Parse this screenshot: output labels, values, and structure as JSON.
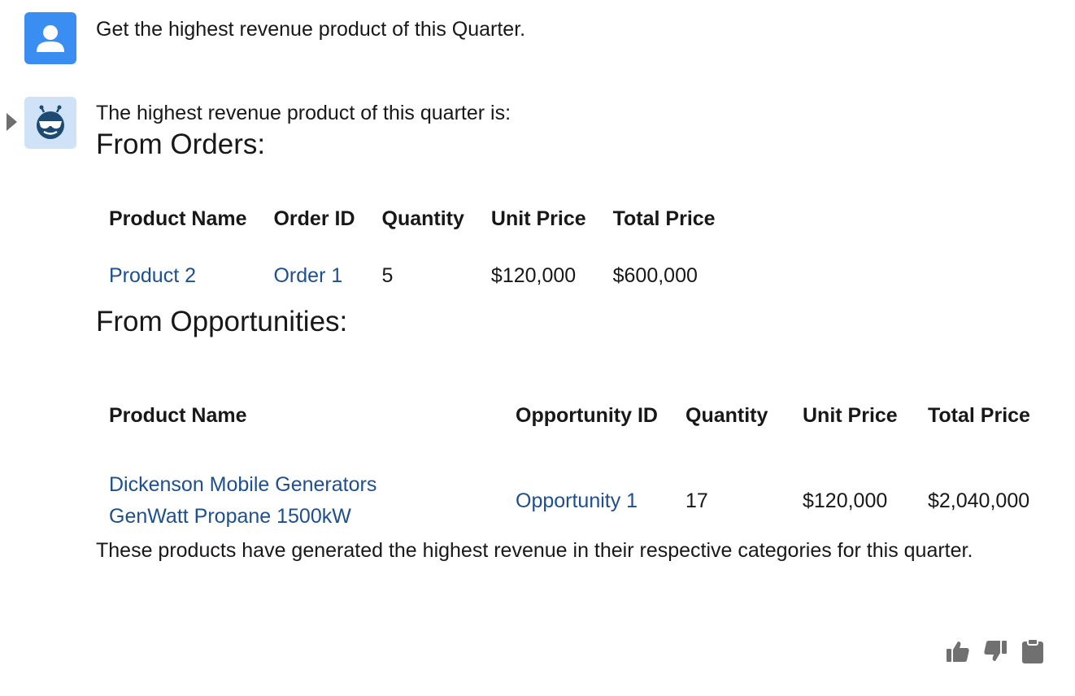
{
  "user_message": {
    "text": "Get the highest revenue product of this Quarter."
  },
  "bot_message": {
    "intro": "The highest revenue product of this quarter is:",
    "orders_section": {
      "heading": "From Orders:",
      "columns": [
        "Product Name",
        "Order ID",
        "Quantity",
        "Unit Price",
        "Total Price"
      ],
      "rows": [
        {
          "product_name": "Product 2",
          "order_id": "Order 1",
          "quantity": "5",
          "unit_price": "$120,000",
          "total_price": "$600,000"
        }
      ]
    },
    "opportunities_section": {
      "heading": "From Opportunities:",
      "columns": [
        "Product Name",
        "Opportunity ID",
        "Quantity",
        "Unit Price",
        "Total Price"
      ],
      "rows": [
        {
          "product_name": "Dickenson Mobile Generators GenWatt Propane 1500kW",
          "opportunity_id": "Opportunity 1",
          "quantity": "17",
          "unit_price": "$120,000",
          "total_price": "$2,040,000"
        }
      ]
    },
    "summary": "These products have generated the highest revenue in their respective categories for this quarter."
  },
  "actions": {
    "icons": [
      "thumbs-up-icon",
      "thumbs-down-icon",
      "clipboard-icon"
    ]
  },
  "colors": {
    "user_avatar_bg": "#3a8ef2",
    "bot_avatar_bg": "#cfe2f7",
    "bot_icon": "#1c4a73",
    "link": "#1d4f91",
    "action_icon": "#707070"
  }
}
